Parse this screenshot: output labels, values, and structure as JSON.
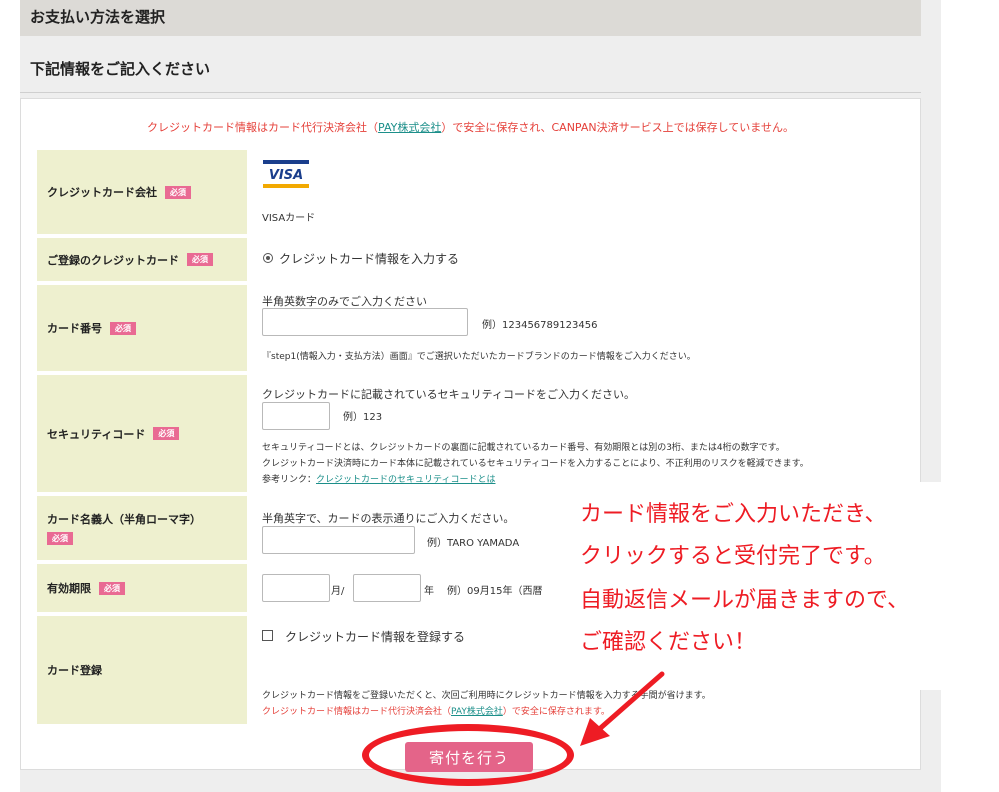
{
  "header": {
    "section_title": "お支払い方法を選択",
    "sub_title": "下記情報をご記入ください"
  },
  "notice": {
    "prefix": "クレジットカード情報はカード代行決済会社（",
    "link": "PAY株式会社",
    "suffix": "）で安全に保存され、CANPAN決済サービス上では保存していません。"
  },
  "required_badge": "必須",
  "card_company": {
    "label": "クレジットカード会社",
    "logo_text": "VISA",
    "value": "VISAカード"
  },
  "registered_card": {
    "label": "ご登録のクレジットカード",
    "option": "クレジットカード情報を入力する"
  },
  "card_number": {
    "label": "カード番号",
    "hint": "半角英数字のみでご入力ください",
    "value": "",
    "example": "例）123456789123456",
    "note": "『step1(情報入力・支払方法）画面』でご選択いただいたカードブランドのカード情報をご入力ください。"
  },
  "security_code": {
    "label": "セキュリティコード",
    "hint": "クレジットカードに記載されているセキュリティコードをご入力ください。",
    "value": "",
    "example": "例）123",
    "note1": "セキュリティコードとは、クレジットカードの裏面に記載されているカード番号、有効期限とは別の3桁、または4桁の数字です。",
    "note2": "クレジットカード決済時にカード本体に記載されているセキュリティコードを入力することにより、不正利用のリスクを軽減できます。",
    "ref_prefix": "参考リンク：",
    "ref_link": "クレジットカードのセキュリティコードとは"
  },
  "card_holder": {
    "label": "カード名義人（半角ローマ字）",
    "hint": "半角英字で、カードの表示通りにご入力ください。",
    "value": "",
    "example": "例）TARO YAMADA"
  },
  "expiry": {
    "label": "有効期限",
    "month_value": "",
    "month_suffix": "月/",
    "year_value": "",
    "year_suffix": "年",
    "example": "例）09月15年（西暦"
  },
  "card_register": {
    "label": "カード登録",
    "checkbox_label": "クレジットカード情報を登録する",
    "note1": "クレジットカード情報をご登録いただくと、次回ご利用時にクレジットカード情報を入力する手間が省けます。",
    "note2_prefix": "クレジットカード情報はカード代行決済会社（",
    "note2_link": "PAY株式会社",
    "note2_suffix": "）で安全に保存されます。"
  },
  "submit_label": "寄付を行う",
  "callout": {
    "line1": "カード情報をご入力いただき、",
    "line2": "クリックすると受付完了です。",
    "line3": "自動返信メールが届きますので、",
    "line4": "ご確認ください！"
  },
  "colors": {
    "accent": "#e46489",
    "annotation": "#ee1c24",
    "label_bg": "#eef0cf",
    "link": "#1c8f8a"
  }
}
